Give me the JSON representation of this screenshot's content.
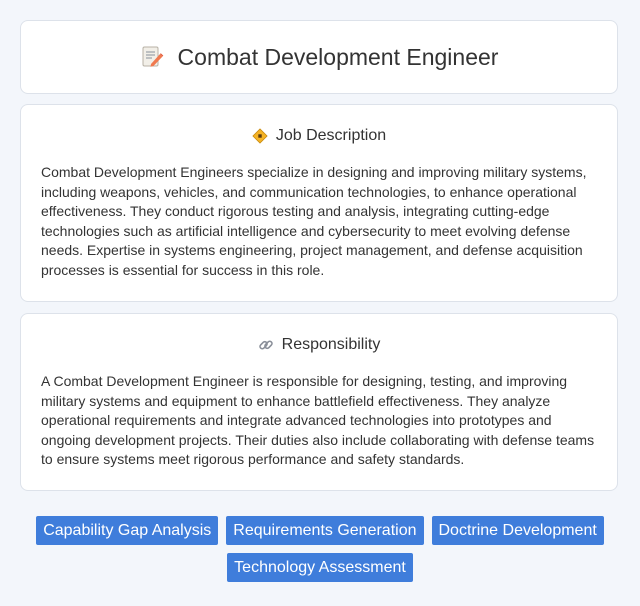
{
  "header": {
    "title": "Combat Development Engineer",
    "icon": "memo-pencil-icon"
  },
  "job_description": {
    "heading": "Job Description",
    "icon": "diamond-sign-icon",
    "text": "Combat Development Engineers specialize in designing and improving military systems, including weapons, vehicles, and communication technologies, to enhance operational effectiveness. They conduct rigorous testing and analysis, integrating cutting-edge technologies such as artificial intelligence and cybersecurity to meet evolving defense needs. Expertise in systems engineering, project management, and defense acquisition processes is essential for success in this role."
  },
  "responsibility": {
    "heading": "Responsibility",
    "icon": "link-icon",
    "text": "A Combat Development Engineer is responsible for designing, testing, and improving military systems and equipment to enhance battlefield effectiveness. They analyze operational requirements and integrate advanced technologies into prototypes and ongoing development projects. Their duties also include collaborating with defense teams to ensure systems meet rigorous performance and safety standards."
  },
  "tags": [
    "Capability Gap Analysis",
    "Requirements Generation",
    "Doctrine Development",
    "Technology Assessment"
  ],
  "colors": {
    "tag_bg": "#3f7ddb",
    "page_bg": "#f3f6fb"
  }
}
